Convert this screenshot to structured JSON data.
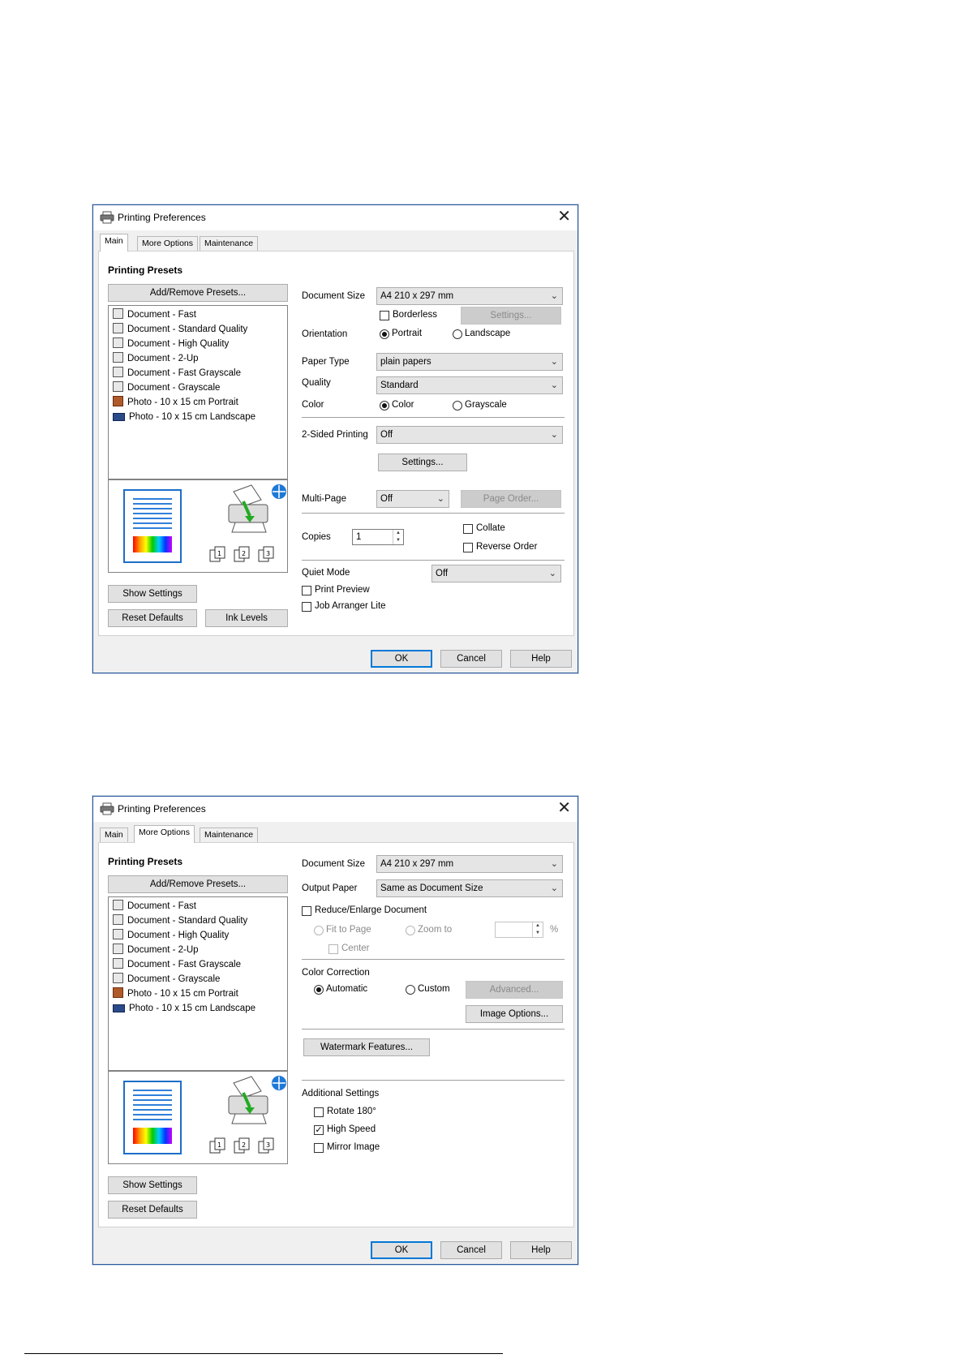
{
  "dialogs": [
    {
      "title": "Printing Preferences",
      "tabs": [
        "Main",
        "More Options",
        "Maintenance"
      ],
      "active_tab": "Main"
    },
    {
      "title": "Printing Preferences",
      "tabs": [
        "Main",
        "More Options",
        "Maintenance"
      ],
      "active_tab": "More Options"
    }
  ],
  "presets": {
    "heading": "Printing Presets",
    "add_remove_label": "Add/Remove Presets...",
    "items": [
      "Document - Fast",
      "Document - Standard Quality",
      "Document - High Quality",
      "Document - 2-Up",
      "Document - Fast Grayscale",
      "Document - Grayscale",
      "Photo - 10 x 15 cm Portrait",
      "Photo - 10 x 15 cm Landscape"
    ]
  },
  "main": {
    "document_size_label": "Document Size",
    "document_size_value": "A4 210 x 297 mm",
    "borderless_label": "Borderless",
    "settings_disabled_label": "Settings...",
    "orientation_label": "Orientation",
    "portrait_label": "Portrait",
    "landscape_label": "Landscape",
    "paper_type_label": "Paper Type",
    "paper_type_value": "plain papers",
    "quality_label": "Quality",
    "quality_value": "Standard",
    "color_label": "Color",
    "color_option_label": "Color",
    "grayscale_label": "Grayscale",
    "two_sided_label": "2-Sided Printing",
    "two_sided_value": "Off",
    "two_sided_settings_label": "Settings...",
    "multi_page_label": "Multi-Page",
    "multi_page_value": "Off",
    "page_order_label": "Page Order...",
    "copies_label": "Copies",
    "copies_value": "1",
    "collate_label": "Collate",
    "reverse_order_label": "Reverse Order",
    "quiet_mode_label": "Quiet Mode",
    "quiet_mode_value": "Off",
    "print_preview_label": "Print Preview",
    "job_arranger_label": "Job Arranger Lite",
    "show_settings_label": "Show Settings",
    "reset_defaults_label": "Reset Defaults",
    "ink_levels_label": "Ink Levels"
  },
  "more_options": {
    "document_size_label": "Document Size",
    "document_size_value": "A4 210 x 297 mm",
    "output_paper_label": "Output Paper",
    "output_paper_value": "Same as Document Size",
    "reduce_enlarge_label": "Reduce/Enlarge Document",
    "fit_to_page_label": "Fit to Page",
    "zoom_to_label": "Zoom to",
    "percent_label": "%",
    "center_label": "Center",
    "color_correction_label": "Color Correction",
    "automatic_label": "Automatic",
    "custom_label": "Custom",
    "advanced_label": "Advanced...",
    "image_options_label": "Image Options...",
    "watermark_label": "Watermark Features...",
    "additional_settings_label": "Additional Settings",
    "rotate_label": "Rotate 180°",
    "high_speed_label": "High Speed",
    "mirror_image_label": "Mirror Image",
    "show_settings_label": "Show Settings",
    "reset_defaults_label": "Reset Defaults"
  },
  "footer_buttons": {
    "ok": "OK",
    "cancel": "Cancel",
    "help": "Help"
  },
  "icons": {
    "app": "printer-icon",
    "close": "close-icon",
    "dropdown": "chevron-down-icon",
    "preview_printer": "printer-preview-icon",
    "online": "globe-icon",
    "copies": "copies-icon"
  },
  "glyphs": {
    "close": "✕",
    "chevron": "⌄",
    "checkmark": "✓",
    "spin_up": "▲",
    "spin_down": "▼"
  },
  "colors": {
    "dialog_border": "#2b579a",
    "default_button_border": "#0078d7",
    "paper_lines": "#2f7fd9"
  }
}
